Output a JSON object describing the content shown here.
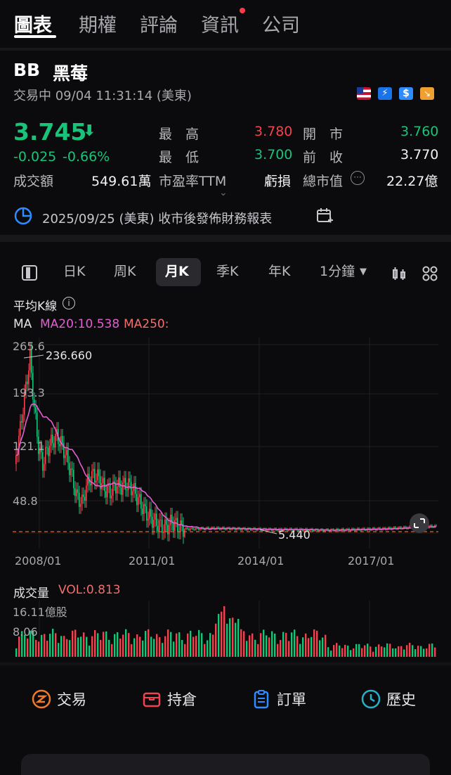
{
  "top_tabs": [
    "圖表",
    "期權",
    "評論",
    "資訊",
    "公司"
  ],
  "stock": {
    "ticker": "BB",
    "name": "黑莓",
    "status": "交易中 09/04 11:31:14 (美東)",
    "price": "3.745",
    "change": "-0.025",
    "change_pct": "-0.66%",
    "turnover_label": "成交額",
    "turnover_value": "549.61萬",
    "high_label": "最　高",
    "high_value": "3.780",
    "low_label": "最　低",
    "low_value": "3.700",
    "pe_label": "市盈率TTM",
    "pe_value": "虧損",
    "open_label": "開　市",
    "open_value": "3.760",
    "prev_label": "前　收",
    "prev_value": "3.770",
    "mcap_label": "總市值",
    "mcap_value": "22.27億"
  },
  "earnings_notice": "2025/09/25 (美東) 收市後發佈財務報表",
  "period_tabs": [
    "日K",
    "周K",
    "月K",
    "季K",
    "年K",
    "1分鐘"
  ],
  "active_period": "月K",
  "chart_header": {
    "avg_label": "平均K線",
    "ma_label": "MA",
    "ma20": "MA20:10.538",
    "ma250": "MA250:"
  },
  "chart_data": {
    "type": "line",
    "y_ticks": [
      "265.6",
      "193.3",
      "121.1",
      "48.8"
    ],
    "x_ticks": [
      "2008/01",
      "2011/01",
      "2014/01",
      "2017/01"
    ],
    "max_label": "236.660",
    "min_label": "5.440",
    "ylim": [
      5.44,
      265.6
    ],
    "colors": {
      "up": "#f0434f",
      "down": "#19c37a",
      "ma20": "#e25fd0",
      "ref_line": "#e0662c"
    }
  },
  "volume": {
    "label": "成交量",
    "vol_value": "VOL:0.813",
    "max_tick": "16.11億股",
    "mid_tick": "8.06"
  },
  "bottom_actions": [
    "交易",
    "持倉",
    "訂單",
    "歷史"
  ]
}
